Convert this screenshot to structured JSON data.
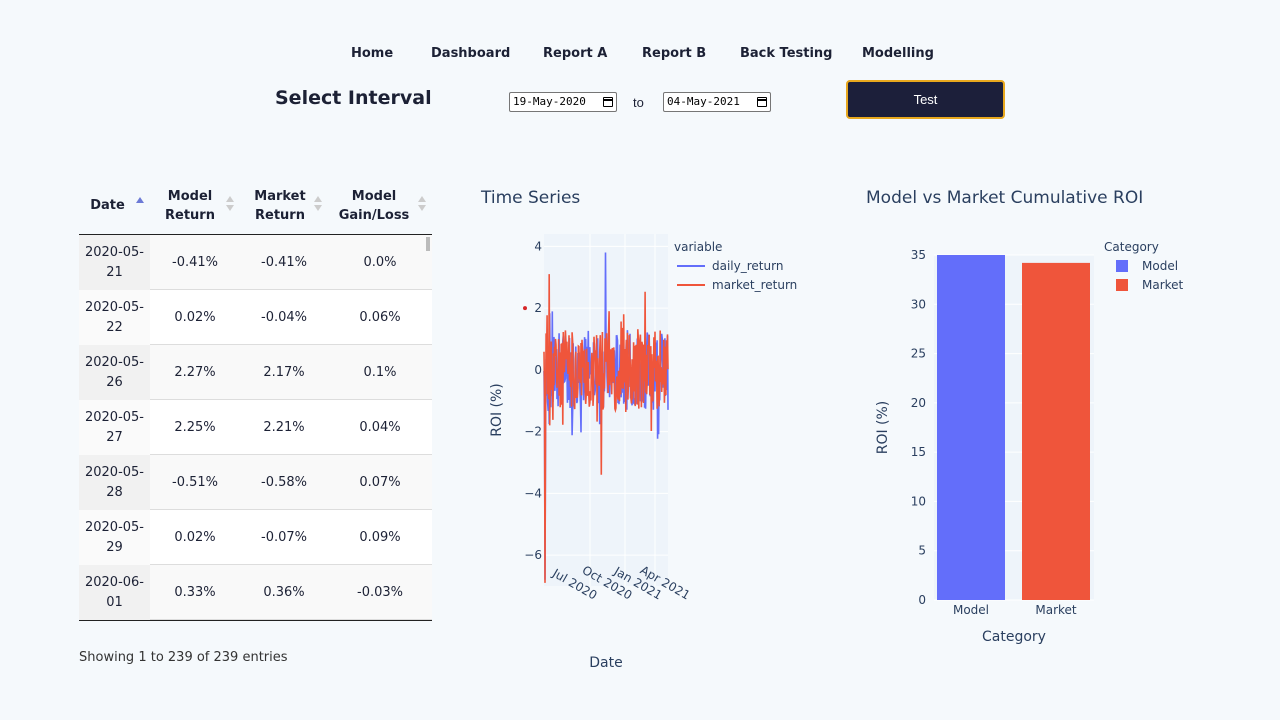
{
  "nav": {
    "items": [
      "Home",
      "Dashboard",
      "Report A",
      "Report B",
      "Back Testing",
      "Modelling"
    ]
  },
  "interval": {
    "title": "Select Interval",
    "start_date": "19-May-2020",
    "to_label": "to",
    "end_date": "04-May-2021",
    "test_label": "Test"
  },
  "colors": {
    "model": "#636efa",
    "market": "#ef553b",
    "button_bg": "#1c1f3a",
    "button_border": "#e8a81e"
  },
  "table": {
    "headers": [
      "Date",
      "Model Return",
      "Market Return",
      "Model Gain/Loss"
    ],
    "sorted_column": "Date",
    "sort_direction": "ascending",
    "rows": [
      [
        "2020-05-21",
        "-0.41%",
        "-0.41%",
        "0.0%"
      ],
      [
        "2020-05-22",
        "0.02%",
        "-0.04%",
        "0.06%"
      ],
      [
        "2020-05-26",
        "2.27%",
        "2.17%",
        "0.1%"
      ],
      [
        "2020-05-27",
        "2.25%",
        "2.21%",
        "0.04%"
      ],
      [
        "2020-05-28",
        "-0.51%",
        "-0.58%",
        "0.07%"
      ],
      [
        "2020-05-29",
        "0.02%",
        "-0.07%",
        "0.09%"
      ],
      [
        "2020-06-01",
        "0.33%",
        "0.36%",
        "-0.03%"
      ]
    ],
    "info": "Showing 1 to 239 of 239 entries"
  },
  "chart_data": [
    {
      "type": "line",
      "title": "Time Series",
      "xlabel": "Date",
      "ylabel": "ROI (%)",
      "ylim": [
        -7,
        4.4
      ],
      "yticks": [
        "4",
        "2",
        "0",
        "−2",
        "−4",
        "−6"
      ],
      "xticks": [
        "Jul 2020",
        "Oct 2020",
        "Jan 2021",
        "Apr 2021"
      ],
      "legend_title": "variable",
      "legend_position": "top-right",
      "series": [
        {
          "name": "daily_return",
          "color": "#636efa",
          "peaks": [
            {
              "date": "2020-05-22",
              "value": -6.8
            },
            {
              "date": "2020-11-09",
              "value": 3.8
            }
          ]
        },
        {
          "name": "market_return",
          "color": "#ef553b",
          "peaks": [
            {
              "date": "2020-05-22",
              "value": -6.9
            },
            {
              "date": "2020-06-03",
              "value": 3.1
            },
            {
              "date": "2020-10-28",
              "value": -3.4
            }
          ]
        }
      ]
    },
    {
      "type": "bar",
      "title": "Model vs Market Cumulative ROI",
      "categories": [
        "Model",
        "Market"
      ],
      "values": [
        35,
        34.2
      ],
      "xlabel": "Category",
      "ylabel": "ROI (%)",
      "ylim": [
        0,
        35
      ],
      "yticks": [
        "0",
        "5",
        "10",
        "15",
        "20",
        "25",
        "30",
        "35"
      ],
      "legend_title": "Category",
      "legend_position": "top-right",
      "grid": true
    }
  ]
}
